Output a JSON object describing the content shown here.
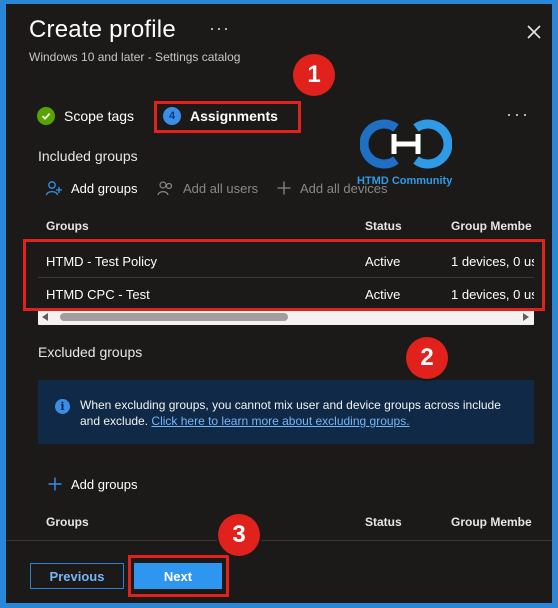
{
  "panel": {
    "title": "Create profile",
    "more": "···",
    "subtitle": "Windows 10 and later - Settings catalog",
    "overflow": "···"
  },
  "tabs": [
    {
      "label": "Scope tags",
      "state": "complete"
    },
    {
      "label": "Assignments",
      "number": "4",
      "state": "active"
    }
  ],
  "included": {
    "title": "Included groups",
    "commands": {
      "add_groups": "Add groups",
      "add_all_users": "Add all users",
      "add_all_devices": "Add all devices"
    },
    "columns": [
      "Groups",
      "Status",
      "Group Membe"
    ],
    "rows": [
      {
        "group": "HTMD - Test Policy",
        "status": "Active",
        "members": "1 devices, 0 us"
      },
      {
        "group": "HTMD CPC - Test",
        "status": "Active",
        "members": "1 devices, 0 us"
      }
    ]
  },
  "excluded": {
    "title": "Excluded groups",
    "info_text": "When excluding groups, you cannot mix user and device groups across include and exclude.",
    "info_link": "Click here to learn more about excluding groups.",
    "add_groups": "Add groups",
    "columns": [
      "Groups",
      "Status",
      "Group Membe"
    ]
  },
  "footer": {
    "previous": "Previous",
    "next": "Next"
  },
  "annotations": [
    "1",
    "2",
    "3"
  ],
  "watermark": {
    "text": "HTMD Community"
  },
  "colors": {
    "accent": "#2f96f0",
    "highlight": "#e1211b",
    "success": "#57a300"
  }
}
